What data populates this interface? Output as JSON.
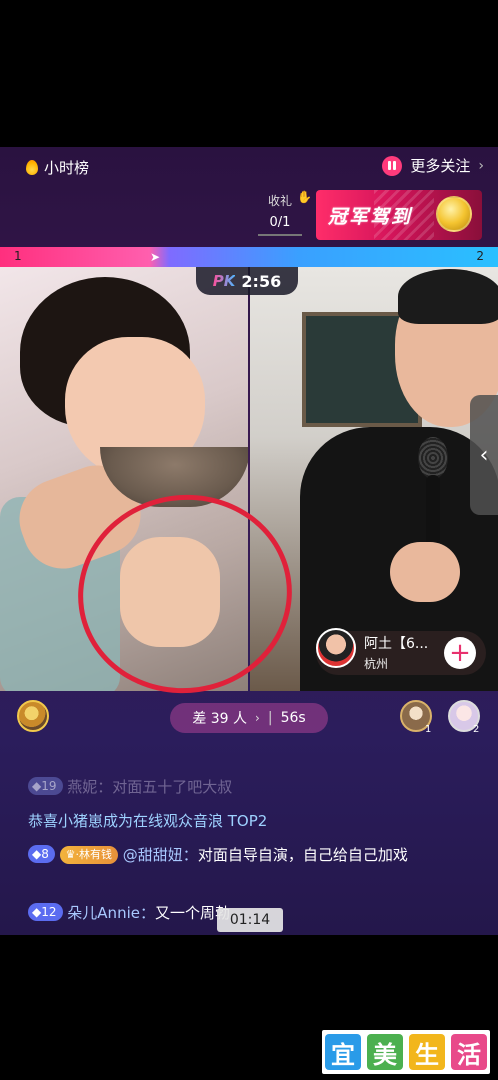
{
  "top": {
    "hour_rank": "小时榜",
    "more_follow": "更多关注",
    "gift_label": "收礼",
    "gift_count": "0/1",
    "champion_banner": "冠军驾到"
  },
  "pk_bar": {
    "left_num": "1",
    "right_num": "2"
  },
  "pk_timer": {
    "pk": "PK",
    "time": "2:56"
  },
  "opponent": {
    "name": "阿土【6...",
    "location": "杭州",
    "add": "+"
  },
  "contrib": {
    "gap_text": "差 39 人",
    "gap_chevron": "›",
    "sep": "|",
    "countdown": "56s",
    "right_ranks": [
      "1",
      "2"
    ]
  },
  "chat": [
    {
      "level": "19",
      "text": "燕妮：对面五十了吧大叔"
    },
    {
      "text": "恭喜小猪崽成为在线观众音浪 TOP2"
    },
    {
      "level": "8",
      "fan_badge": "林有钱",
      "user": "@甜甜妞：",
      "text": "对面自导自演，自己给自己加戏"
    },
    {
      "level": "12",
      "user": "朵儿Annie：",
      "text": "又一个周勃"
    }
  ],
  "video_time": "01:14",
  "side_tab_icon": "chevron-left-icon",
  "watermark": {
    "chars": [
      "宜",
      "美",
      "生",
      "活"
    ],
    "colors": [
      "#2a9be8",
      "#4cb050",
      "#f2b61c",
      "#e84a8a"
    ]
  },
  "colors": {
    "pk_pink": "#ff2f7e",
    "pk_blue": "#2ac0ff",
    "champion": "#d4145a",
    "annotation_red": "#e0213a",
    "system_msg": "#9ed2ff"
  }
}
